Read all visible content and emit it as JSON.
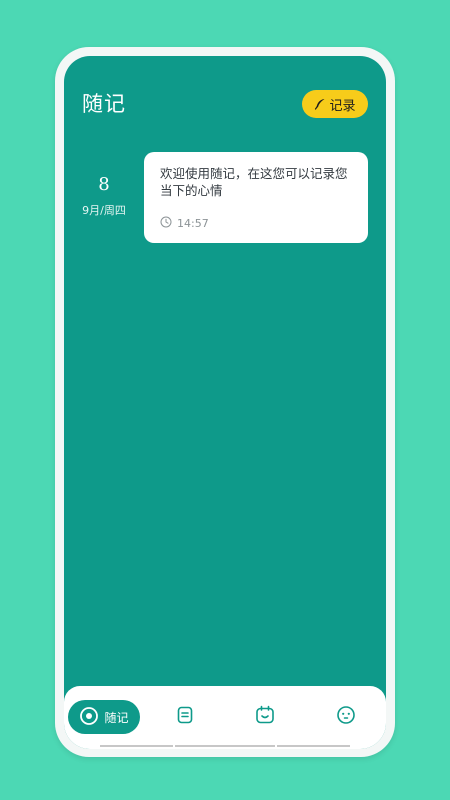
{
  "header": {
    "title": "随记",
    "record_button_label": "记录"
  },
  "entries": [
    {
      "day": "8",
      "month_weekday": "9月/周四",
      "text": "欢迎使用随记，在这您可以记录您当下的心情",
      "time": "14:57"
    }
  ],
  "bottom_nav": {
    "active_label": "随记",
    "items": [
      {
        "icon": "disc-icon",
        "label": "随记",
        "active": true
      },
      {
        "icon": "note-icon",
        "active": false
      },
      {
        "icon": "calendar-face-icon",
        "active": false
      },
      {
        "icon": "face-icon",
        "active": false
      }
    ]
  },
  "colors": {
    "background": "#4cd8b4",
    "screen": "#0e9a8a",
    "accent_button": "#f7cc1a",
    "card": "#ffffff"
  }
}
